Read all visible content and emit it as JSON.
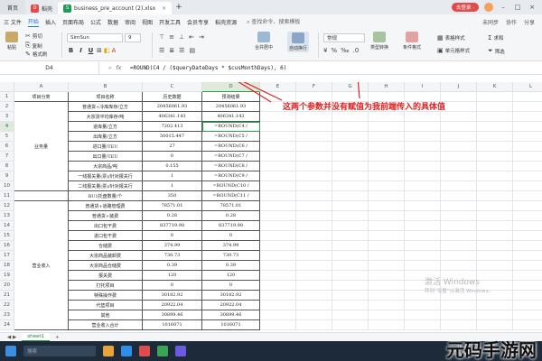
{
  "titlebar": {
    "home": "首页",
    "tabs": [
      {
        "label": "稻壳",
        "logo_color": "#e04b4b"
      },
      {
        "label": "business_pre_account (2).xlsx",
        "logo_color": "#1f9d55"
      }
    ],
    "login": "去登录 ·",
    "close_glyph": "×"
  },
  "menubar": {
    "items": [
      "三 文件",
      "开始",
      "插入",
      "页面布局",
      "公式",
      "数据",
      "审阅",
      "视图",
      "开发工具",
      "会员专享",
      "稻壳资源"
    ],
    "active_index": 1,
    "search": "查找命令、搜索模板",
    "right": [
      "未同步",
      "协作",
      "分享"
    ]
  },
  "ribbon": {
    "paste": "粘贴",
    "cut": "剪切",
    "copy": "复制",
    "format_painter": "格式刷",
    "font_name": "SimSun",
    "font_size": "9",
    "bold": "B",
    "italic": "I",
    "underline": "U",
    "merge_center": "合并居中",
    "wrap": "自动换行",
    "number_format": "常规",
    "type_convert": "类型转换",
    "conditional_format": "条件格式",
    "table_style": "表格样式",
    "cell_style": "单元格样式",
    "sum": "求和",
    "filter": "筛选"
  },
  "formula_bar": {
    "name_box": "D4",
    "fx": "fx",
    "formula": "=ROUND(C4 / ($queryDateDays * $cusMonthDays), 6)"
  },
  "columns": [
    "A",
    "B",
    "C",
    "D",
    "E",
    "F",
    "G",
    "H",
    "I",
    "J",
    "K",
    "L"
  ],
  "selected_column": "D",
  "rows": [
    {
      "n": "1",
      "a": "项目分类",
      "b": "项目名称",
      "c": "历史数据",
      "d": "预测结果"
    },
    {
      "n": "2",
      "a": "",
      "b": "普通货+冷库库存/立方",
      "c": "20456061.93",
      "d": "20456061.93"
    },
    {
      "n": "3",
      "a": "",
      "b": "大宗货平均库存/吨",
      "c": "406341.143",
      "d": "406341.143"
    },
    {
      "n": "4",
      "a": "",
      "b": "进库量/立方",
      "c": "7202.413",
      "d": "=ROUND(C4 /"
    },
    {
      "n": "5",
      "a": "",
      "b": "出库量/立方",
      "c": "50015.447",
      "d": "=ROUND(C5 /"
    },
    {
      "n": "6",
      "a": "",
      "b": "进口量/TEU",
      "c": "27",
      "d": "=ROUND(C6 /"
    },
    {
      "n": "7",
      "a": "",
      "b": "出口量/TEU",
      "c": "0",
      "d": "=ROUND(C7 /"
    },
    {
      "n": "8",
      "a": "",
      "b": "大宗商品/吨",
      "c": "0.155",
      "d": "=ROUND(C8 /"
    },
    {
      "n": "9",
      "a": "",
      "b": "一线报关量(票)/针对报关行",
      "c": "1",
      "d": "=ROUND(C9 /"
    },
    {
      "n": "10",
      "a": "",
      "b": "二线报关量(票)/针对报关行",
      "c": "1",
      "d": "=ROUND(C10 /"
    },
    {
      "n": "11",
      "a": "",
      "b": "BU1托盘数量/个",
      "c": "350",
      "d": "=ROUND(C11 /"
    },
    {
      "n": "12",
      "a": "",
      "b": "普通货+道路管理费",
      "c": "78571.01",
      "d": "78571.01"
    },
    {
      "n": "13",
      "a": "",
      "b": "普通货+装费",
      "c": "0.28",
      "d": "0.28"
    },
    {
      "n": "14",
      "a": "",
      "b": "出口包干费",
      "c": "837719.98",
      "d": "837719.98"
    },
    {
      "n": "15",
      "a": "",
      "b": "进口包干费",
      "c": "0",
      "d": "0"
    },
    {
      "n": "16",
      "a": "",
      "b": "仓储费",
      "c": "374.99",
      "d": "374.99"
    },
    {
      "n": "17",
      "a": "",
      "b": "大宗商品装卸费",
      "c": "730.73",
      "d": "730.73"
    },
    {
      "n": "18",
      "a": "",
      "b": "大宗商品仓储费",
      "c": "0.39",
      "d": "0.39"
    },
    {
      "n": "19",
      "a": "",
      "b": "报关费",
      "c": "120",
      "d": "120"
    },
    {
      "n": "20",
      "a": "",
      "b": "打托项目",
      "c": "0",
      "d": "0"
    },
    {
      "n": "21",
      "a": "",
      "b": "特殊操作费",
      "c": "30182.92",
      "d": "30182.92"
    },
    {
      "n": "22",
      "a": "",
      "b": "代垫项目",
      "c": "20922.04",
      "d": "20922.04"
    },
    {
      "n": "23",
      "a": "",
      "b": "其他",
      "c": "30899.46",
      "d": "30899.46"
    },
    {
      "n": "24",
      "a": "",
      "b": "营业收入合计",
      "c": "1016071",
      "d": "1016071"
    }
  ],
  "merged_groups": [
    {
      "label": "业务量"
    },
    {
      "label": "营业收入"
    }
  ],
  "annotation": "这两个参数并没有赋值为我前端传入的具体值",
  "watermark": {
    "line1": "激活 Windows",
    "line2": "转到“设置”以激活 Windows。"
  },
  "sheet_tab": "sheet1",
  "taskbar": {
    "search": "搜索",
    "time": "16:43",
    "date": "2024/6/6"
  },
  "brand": "元码手游网",
  "colors": {
    "accent_green": "#27a347",
    "annotation_red": "#e02020"
  }
}
